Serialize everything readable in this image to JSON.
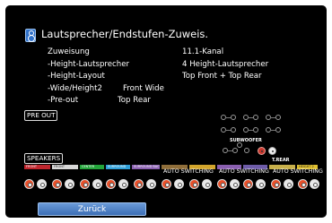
{
  "header": {
    "icon": "speaker-icon",
    "title": "Lautsprecher/Endstufen-Zuweis."
  },
  "settings": [
    {
      "label": "Zuweisung",
      "value": "11.1-Kanal"
    },
    {
      "label": "-Height-Lautsprecher",
      "value": "4 Height-Lautsprecher"
    },
    {
      "label": "-Height-Layout",
      "value": "Top Front + Top Rear"
    },
    {
      "label": "-Wide/Height2",
      "value": "Front Wide"
    },
    {
      "label": "-Pre-out",
      "value": "Top Rear"
    }
  ],
  "preout": {
    "label": "PRE OUT",
    "subwoofer": "SUBWOOFER",
    "trear": "T.REAR"
  },
  "speakers": {
    "label": "SPEAKERS",
    "tags": [
      {
        "text": "FRONT",
        "color": "#c0262e"
      },
      {
        "text": "FRONT",
        "color": "#d8d8d8"
      },
      {
        "text": "CENTER",
        "color": "#23a43a"
      },
      {
        "text": "SURROUND",
        "color": "#2e9fd8"
      },
      {
        "text": "SURROUND BACK",
        "color": "#8a5fb0"
      },
      {
        "text": "",
        "color": "#8f6e3a"
      },
      {
        "text": "",
        "color": "#d2a52c"
      },
      {
        "text": "",
        "color": "#8a5fb0"
      },
      {
        "text": "",
        "color": "#6e5ca8"
      },
      {
        "text": "",
        "color": "#c8b04a"
      },
      {
        "text": "HEIGHT 2",
        "color": "#e0c030"
      }
    ],
    "auto_switching": [
      "AUTO SWITCHING",
      "AUTO SWITCHING",
      "AUTO SWITCHING"
    ]
  },
  "back_button": {
    "label": "Zurück"
  }
}
